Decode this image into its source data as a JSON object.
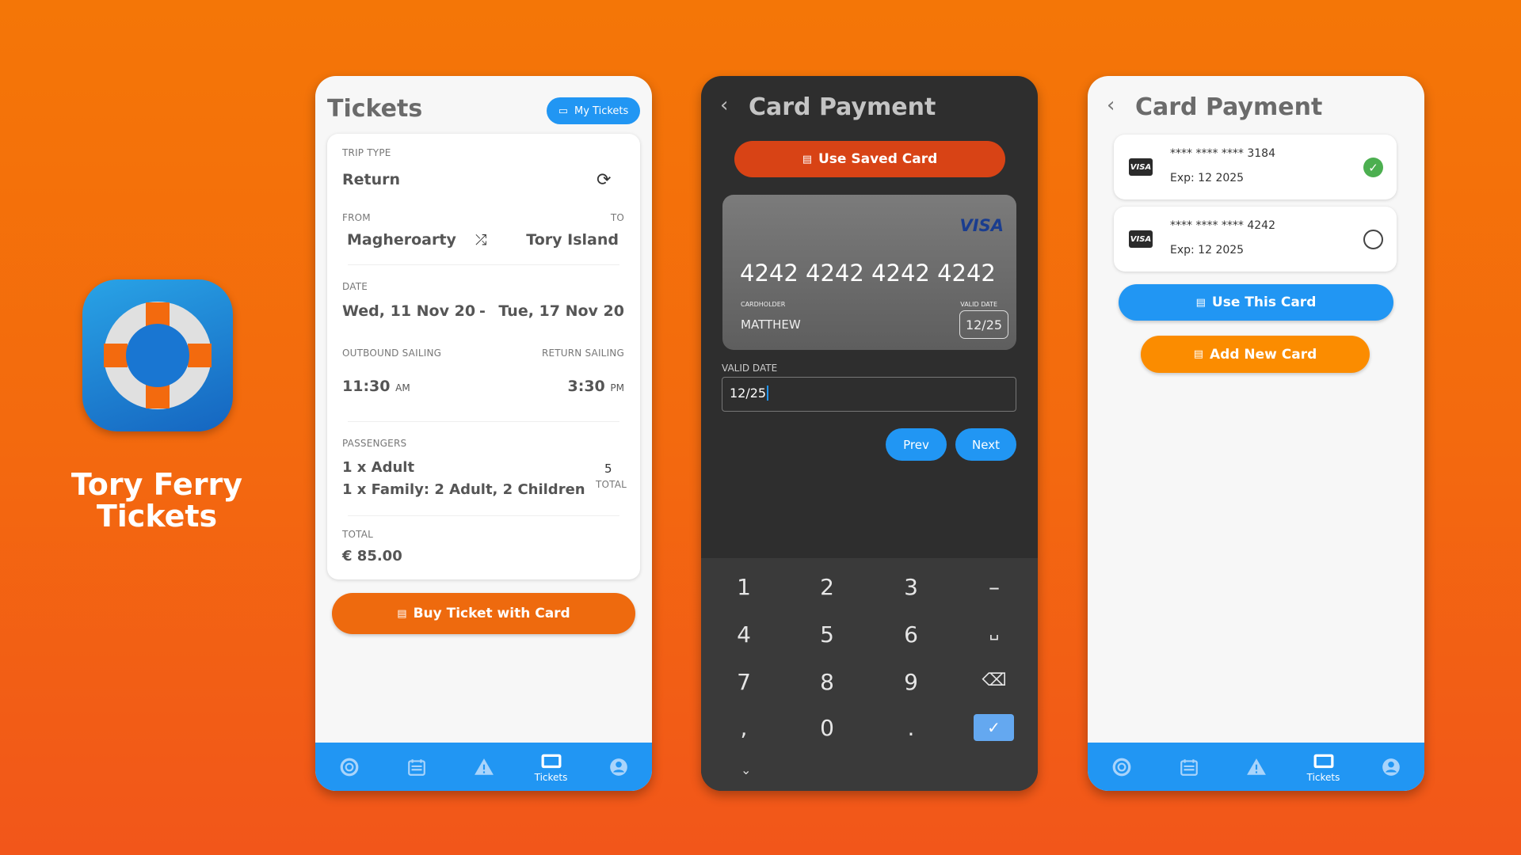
{
  "brand": {
    "app_name": "Tory Ferry Tickets",
    "background_color": "#F36A0E",
    "primary_blue": "#2196F3",
    "accent_orange": "#EE6A0E"
  },
  "screen_tickets": {
    "title": "Tickets",
    "my_tickets_label": "My Tickets",
    "trip_type_label": "TRIP TYPE",
    "trip_type_value": "Return",
    "from_label": "FROM",
    "to_label": "TO",
    "from_value": "Magheroarty",
    "to_value": "Tory Island",
    "date_label": "DATE",
    "date_from": "Wed, 11 Nov 20",
    "date_sep": "-",
    "date_to": "Tue, 17 Nov 20",
    "outbound_label": "OUTBOUND SAILING",
    "return_label": "RETURN SAILING",
    "outbound_time": "11:30",
    "outbound_ampm": "AM",
    "return_time": "3:30",
    "return_ampm": "PM",
    "passengers_label": "PASSENGERS",
    "passenger_lines": [
      "1 x Adult",
      "1 x Family: 2 Adult, 2 Children"
    ],
    "passenger_count": "5",
    "passenger_count_label": "TOTAL",
    "total_label": "TOTAL",
    "total_value": "€ 85.00",
    "buy_label": "Buy Ticket with Card"
  },
  "screen_card_entry": {
    "title": "Card Payment",
    "use_saved_label": "Use Saved Card",
    "card_brand": "VISA",
    "card_number": "4242 4242 4242 4242",
    "cardholder_label": "CARDHOLDER",
    "cardholder_value": "MATTHEW",
    "valid_label": "VALID DATE",
    "valid_value": "12/25",
    "field_label": "VALID DATE",
    "field_value": "12/25",
    "prev_label": "Prev",
    "next_label": "Next",
    "keys": [
      "1",
      "2",
      "3",
      "–",
      "4",
      "5",
      "6",
      "␣",
      "7",
      "8",
      "9",
      "⌫",
      ",",
      "0",
      ".",
      "✓"
    ]
  },
  "screen_saved_cards": {
    "title": "Card Payment",
    "cards": [
      {
        "brand": "VISA",
        "number": "**** **** **** 3184",
        "expiry": "Exp: 12 2025",
        "selected": true
      },
      {
        "brand": "VISA",
        "number": "**** **** **** 4242",
        "expiry": "Exp: 12 2025",
        "selected": false
      }
    ],
    "use_card_label": "Use This Card",
    "add_card_label": "Add New Card"
  },
  "bottom_nav": {
    "items": [
      {
        "icon": "lifebuoy-icon"
      },
      {
        "icon": "calendar-icon"
      },
      {
        "icon": "warning-icon"
      },
      {
        "icon": "ticket-icon",
        "label": "Tickets",
        "active": true
      },
      {
        "icon": "account-icon"
      }
    ]
  }
}
